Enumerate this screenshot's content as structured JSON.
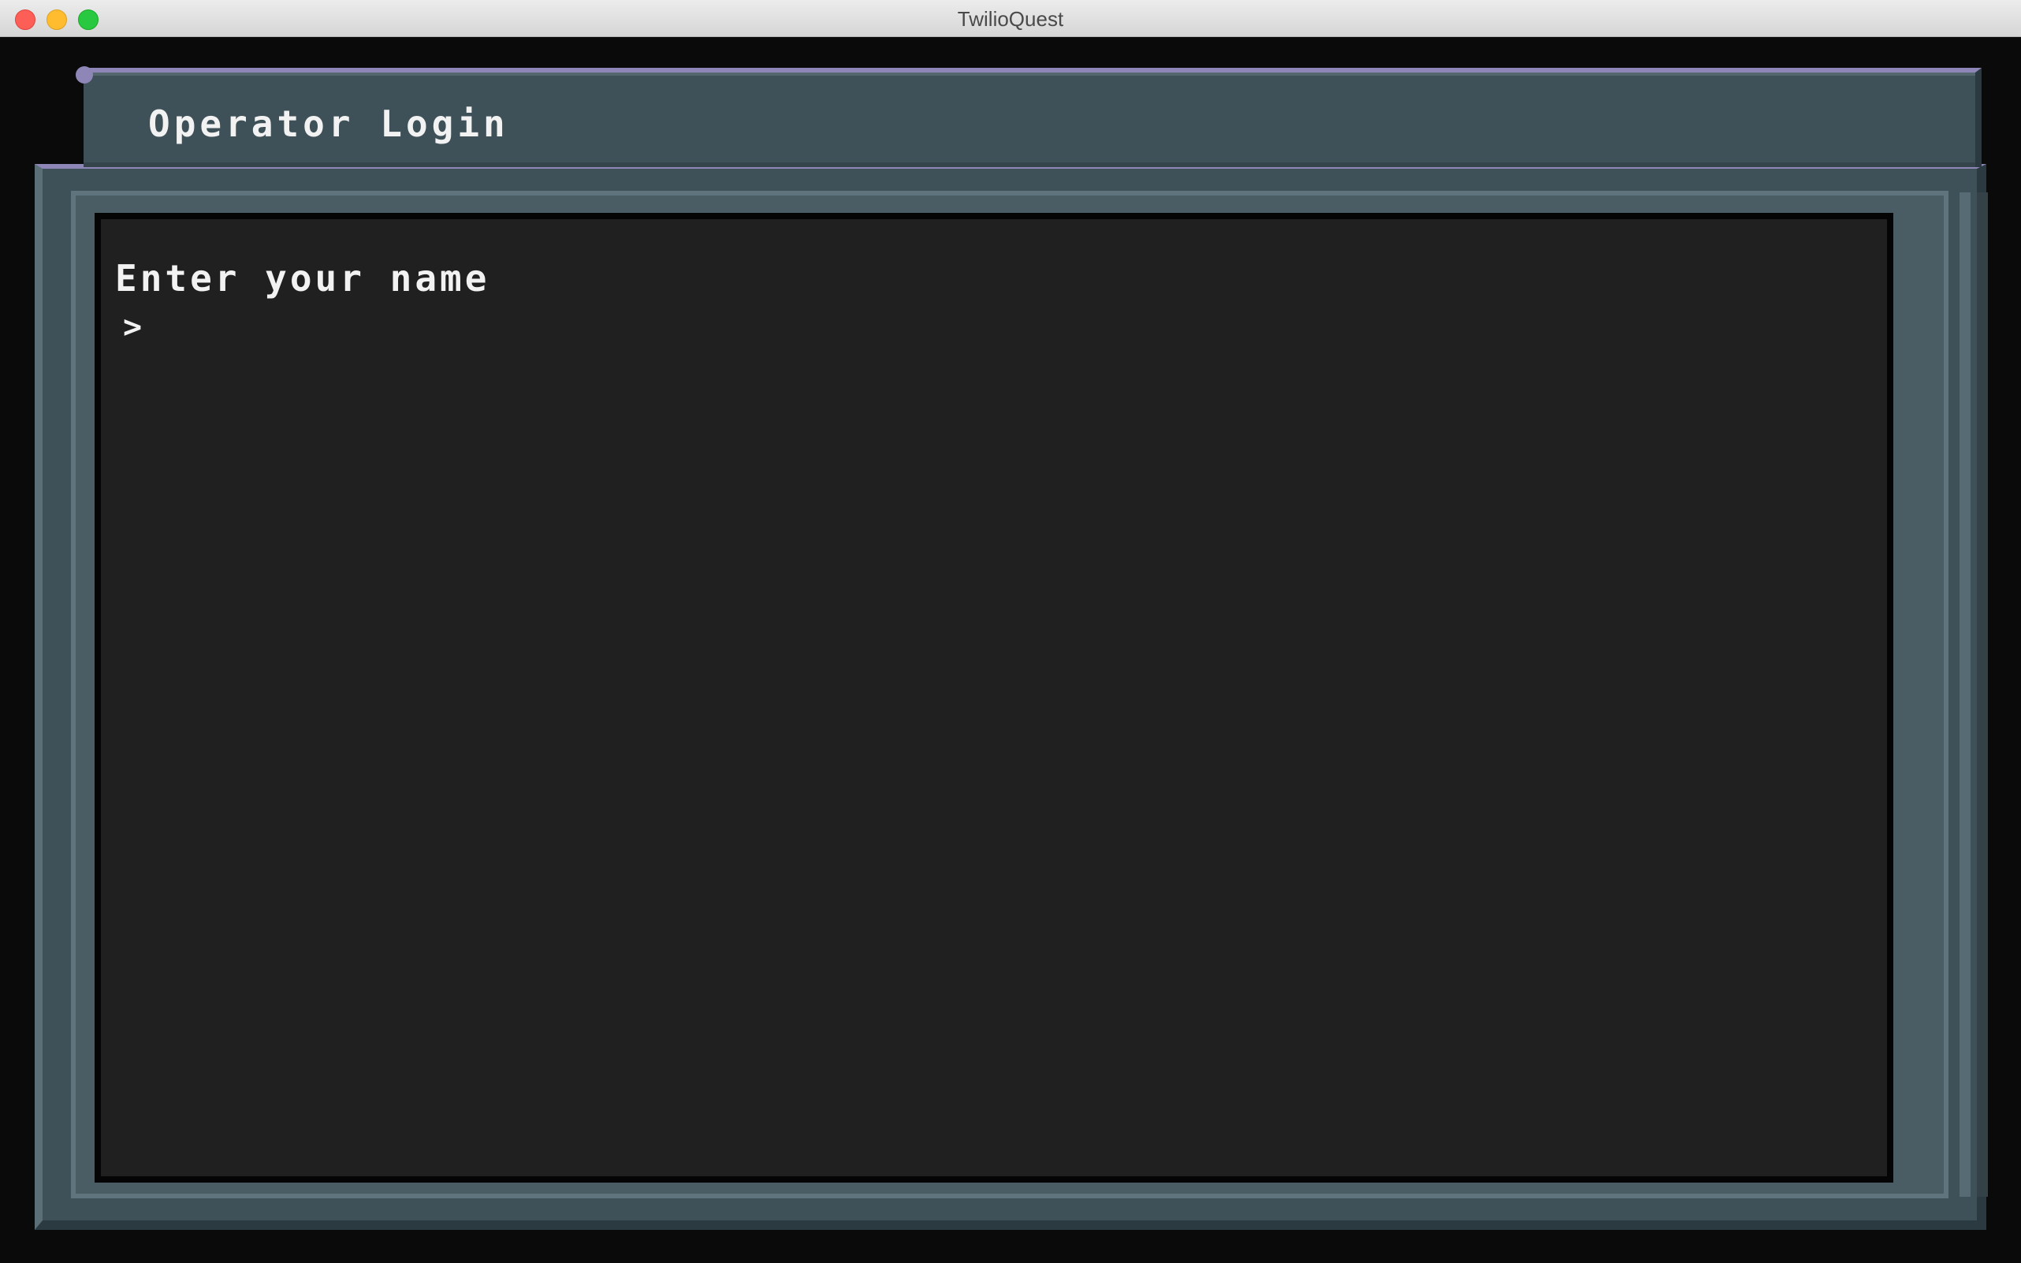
{
  "window": {
    "title": "TwilioQuest"
  },
  "panel": {
    "title": "Operator Login"
  },
  "terminal": {
    "prompt_label": "Enter your name",
    "prompt_symbol": ">",
    "input_value": ""
  },
  "colors": {
    "frame": "#3f5158",
    "frame_accent": "#8e86b6",
    "screen": "#202020",
    "text": "#f2f2f2"
  }
}
